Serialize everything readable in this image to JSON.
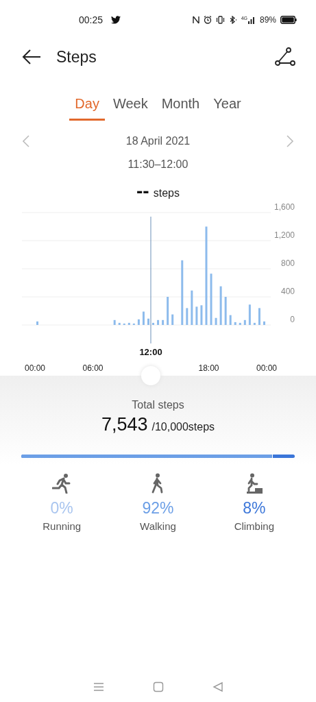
{
  "status_bar": {
    "time": "00:25",
    "network": "4G",
    "battery": "89%"
  },
  "header": {
    "title": "Steps"
  },
  "tabs": [
    {
      "label": "Day",
      "selected": true
    },
    {
      "label": "Week",
      "selected": false
    },
    {
      "label": "Month",
      "selected": false
    },
    {
      "label": "Year",
      "selected": false
    }
  ],
  "date": "18 April 2021",
  "time_range": "11:30–12:00",
  "reading": {
    "value": "--",
    "unit": "steps"
  },
  "chart": {
    "chart_data": {
      "type": "bar",
      "grid": true,
      "ref_lines": [
        {
          "axis": "x",
          "value": 12,
          "label": "12:00"
        }
      ],
      "x": [
        0,
        0.5,
        1,
        1.5,
        2,
        2.5,
        3,
        3.5,
        4,
        4.5,
        5,
        5.5,
        6,
        6.5,
        7,
        7.5,
        8,
        8.5,
        9,
        9.5,
        10,
        10.5,
        11,
        11.5,
        12,
        12.5,
        13,
        13.5,
        14,
        14.5,
        15,
        15.5,
        16,
        16.5,
        17,
        17.5,
        18,
        18.5,
        19,
        19.5,
        20,
        20.5,
        21,
        21.5,
        22,
        22.5,
        23,
        23.5
      ],
      "values": [
        50,
        null,
        null,
        null,
        null,
        null,
        null,
        null,
        null,
        null,
        null,
        null,
        null,
        null,
        null,
        null,
        70,
        30,
        20,
        30,
        20,
        80,
        190,
        90,
        30,
        70,
        70,
        400,
        150,
        null,
        920,
        240,
        490,
        260,
        280,
        1400,
        730,
        100,
        550,
        400,
        140,
        40,
        30,
        70,
        290,
        30,
        240,
        50
      ],
      "xlim": [
        0,
        24
      ],
      "ylim": [
        0,
        1600
      ],
      "xticks": [
        {
          "value": 0,
          "label": "00:00"
        },
        {
          "value": 6,
          "label": "06:00"
        },
        {
          "value": 18,
          "label": "18:00"
        },
        {
          "value": 24,
          "label": "00:00"
        }
      ],
      "yticks": [
        {
          "value": 0,
          "label": "0"
        },
        {
          "value": 400,
          "label": "400"
        },
        {
          "value": 800,
          "label": "800"
        },
        {
          "value": 1200,
          "label": "1,200"
        },
        {
          "value": 1600,
          "label": "1,600"
        }
      ]
    }
  },
  "summary": {
    "title": "Total steps",
    "total": "7,543",
    "goal": "/10,000steps"
  },
  "split_bar": {
    "level": 0.92
  },
  "activities": [
    {
      "kind": "running",
      "percent": "0%",
      "label": "Running",
      "color": "#a9c5ef"
    },
    {
      "kind": "walking",
      "percent": "92%",
      "label": "Walking",
      "color": "#6c9fe6"
    },
    {
      "kind": "climbing",
      "percent": "8%",
      "label": "Climbing",
      "color": "#3b76d9"
    }
  ]
}
